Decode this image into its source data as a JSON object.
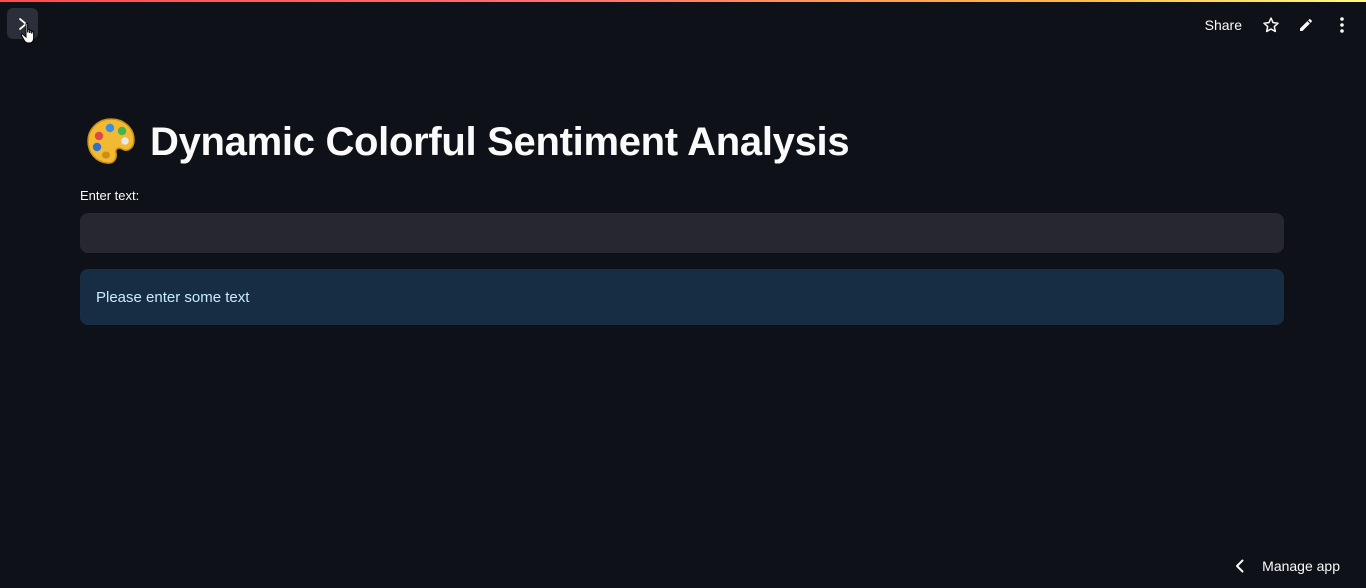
{
  "header": {
    "share_label": "Share",
    "icons": [
      "sidebar-expand-icon",
      "star-icon",
      "pencil-icon",
      "kebab-menu-icon"
    ]
  },
  "main": {
    "title_icon": "palette-icon",
    "title": "Dynamic Colorful Sentiment Analysis",
    "input": {
      "label": "Enter text:",
      "value": "",
      "placeholder": ""
    },
    "info_message": "Please enter some text"
  },
  "footer": {
    "manage_app_label": "Manage app"
  },
  "colors": {
    "background": "#0e1117",
    "input_background": "#262730",
    "info_background": "#172d43",
    "info_text": "#c7ebff",
    "accent_gradient_start": "#ff4b4b",
    "accent_gradient_end": "#fffd80"
  }
}
